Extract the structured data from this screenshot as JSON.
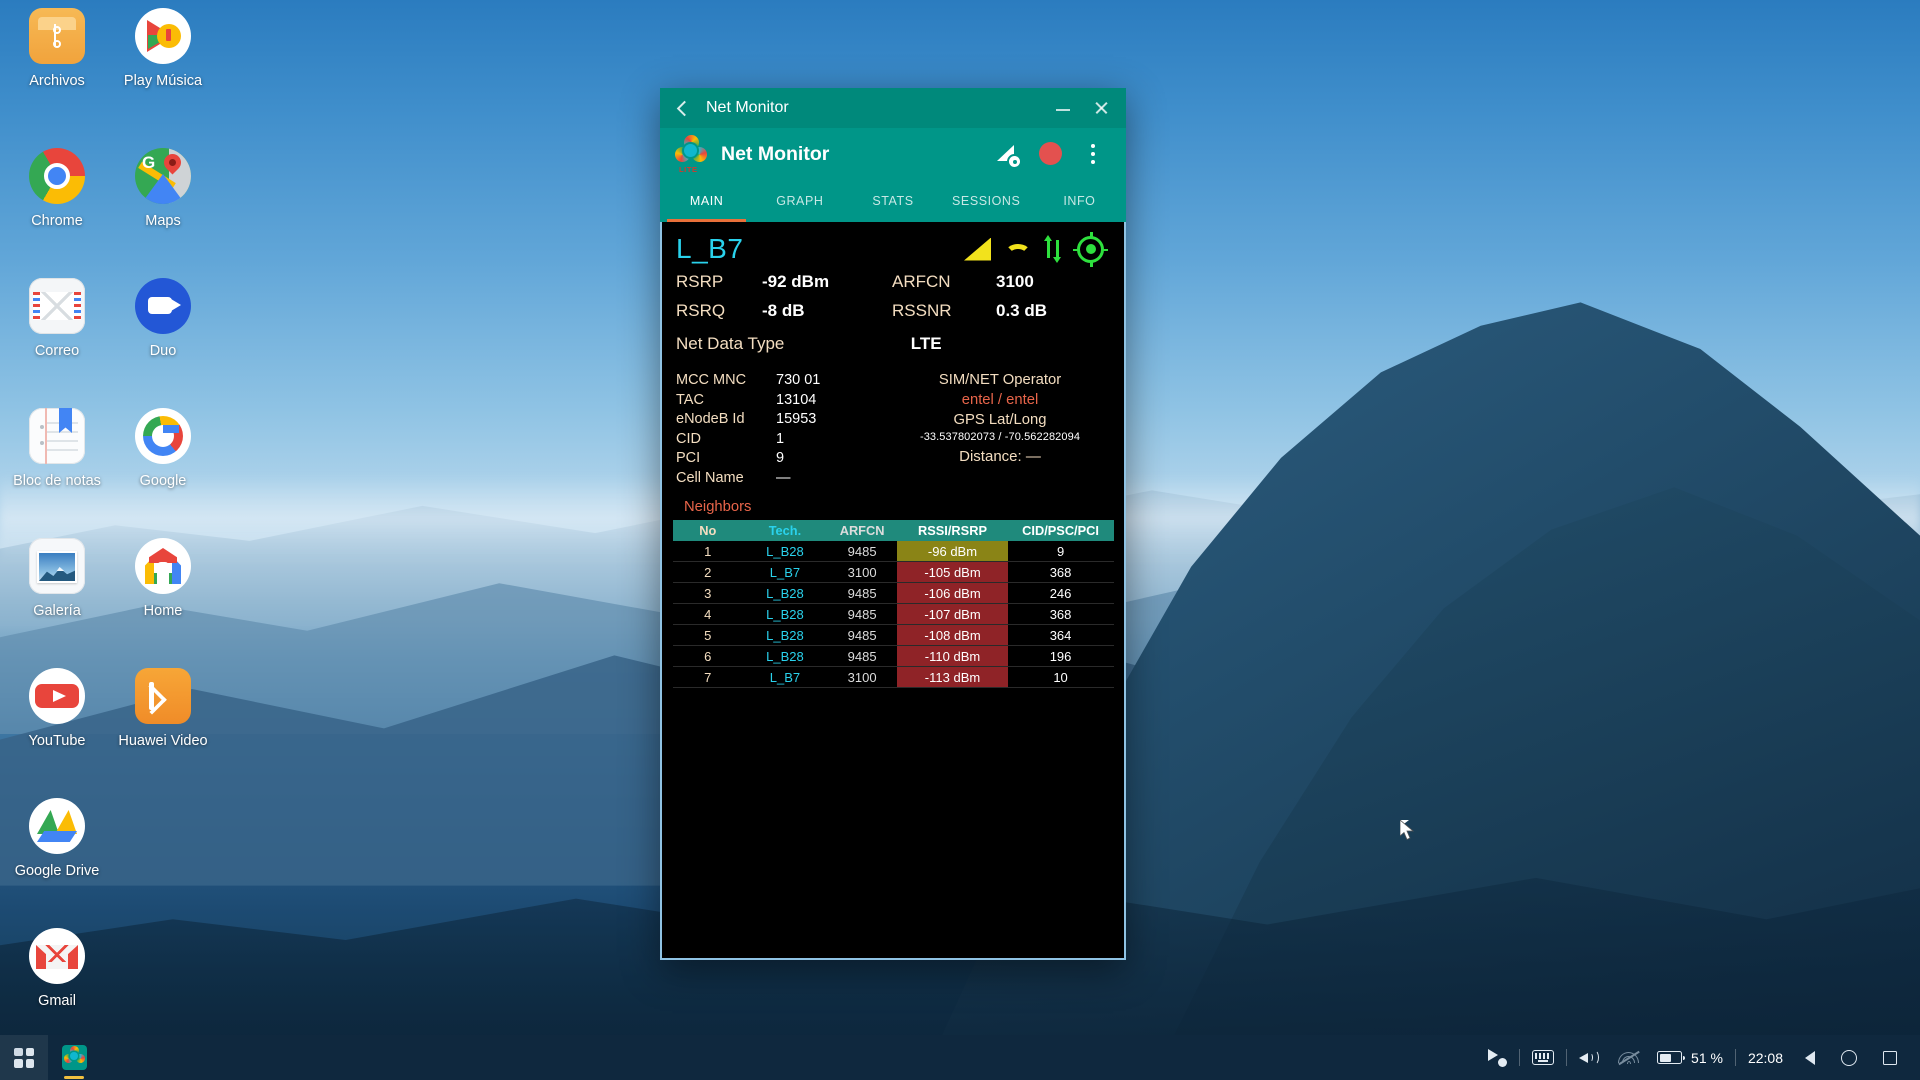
{
  "desktop": {
    "icons": [
      {
        "label": "Archivos",
        "icon": "files-icon"
      },
      {
        "label": "Play Música",
        "icon": "play-music-icon"
      },
      {
        "label": "Chrome",
        "icon": "chrome-icon"
      },
      {
        "label": "Maps",
        "icon": "maps-icon"
      },
      {
        "label": "Correo",
        "icon": "mail-icon"
      },
      {
        "label": "Duo",
        "icon": "duo-icon"
      },
      {
        "label": "Bloc de notas",
        "icon": "notepad-icon"
      },
      {
        "label": "Google",
        "icon": "google-icon"
      },
      {
        "label": "Galería",
        "icon": "gallery-icon"
      },
      {
        "label": "Home",
        "icon": "google-home-icon"
      },
      {
        "label": "YouTube",
        "icon": "youtube-icon"
      },
      {
        "label": "Huawei Video",
        "icon": "huawei-video-icon"
      },
      {
        "label": "Google Drive",
        "icon": "google-drive-icon"
      },
      {
        "label": "Gmail",
        "icon": "gmail-icon"
      }
    ]
  },
  "window": {
    "titlebar": {
      "back_icon": "chevron-left-icon",
      "title": "Net Monitor",
      "minimize_icon": "minimize-icon",
      "close_icon": "close-icon"
    },
    "appbar": {
      "logo_icon": "net-monitor-logo-icon",
      "logo_badge": "LITE",
      "app_name": "Net Monitor",
      "actions": [
        {
          "icon": "signal-settings-icon"
        },
        {
          "icon": "record-icon",
          "color": "#e3514f"
        },
        {
          "icon": "more-vertical-icon"
        }
      ]
    },
    "tabs": [
      {
        "label": "MAIN",
        "active": true
      },
      {
        "label": "GRAPH",
        "active": false
      },
      {
        "label": "STATS",
        "active": false
      },
      {
        "label": "SESSIONS",
        "active": false
      },
      {
        "label": "INFO",
        "active": false
      }
    ],
    "accent_color": "#e8703a",
    "bar_color": "#009688"
  },
  "main": {
    "band": "L_B7",
    "status_icons": [
      {
        "icon": "signal-bars-icon",
        "color": "#f2e21c"
      },
      {
        "icon": "call-end-icon",
        "color": "#f2e21c"
      },
      {
        "icon": "data-transfer-icon",
        "color": "#2ee03e"
      },
      {
        "icon": "gps-fix-icon",
        "color": "#2ee03e"
      }
    ],
    "metrics": [
      {
        "key": "RSRP",
        "value": "-92 dBm",
        "key2": "ARFCN",
        "value2": "3100"
      },
      {
        "key": "RSRQ",
        "value": "-8 dB",
        "key2": "RSSNR",
        "value2": "0.3 dB"
      }
    ],
    "net_data_type": {
      "label": "Net Data Type",
      "value": "LTE"
    },
    "left_fields": [
      {
        "key": "MCC MNC",
        "value": "730 01"
      },
      {
        "key": "TAC",
        "value": "13104"
      },
      {
        "key": "eNodeB Id",
        "value": "15953"
      },
      {
        "key": "CID",
        "value": "1"
      },
      {
        "key": "PCI",
        "value": "9"
      },
      {
        "key": "Cell Name",
        "value": "—"
      }
    ],
    "right_block": {
      "operator_label": "SIM/NET Operator",
      "operator_value": "entel / entel",
      "gps_label": "GPS Lat/Long",
      "gps_value": "-33.537802073 / -70.562282094",
      "distance": "Distance: —"
    },
    "neighbors": {
      "title": "Neighbors",
      "columns": [
        "No",
        "Tech.",
        "ARFCN",
        "RSSI/RSRP",
        "CID/PSC/PCI"
      ],
      "rows": [
        {
          "no": "1",
          "tech": "L_B28",
          "arfcn": "9485",
          "rssi": "-96 dBm",
          "cid": "9",
          "rssi_bg": "#8a8416"
        },
        {
          "no": "2",
          "tech": "L_B7",
          "arfcn": "3100",
          "rssi": "-105 dBm",
          "cid": "368",
          "rssi_bg": "#8f2327"
        },
        {
          "no": "3",
          "tech": "L_B28",
          "arfcn": "9485",
          "rssi": "-106 dBm",
          "cid": "246",
          "rssi_bg": "#8f2327"
        },
        {
          "no": "4",
          "tech": "L_B28",
          "arfcn": "9485",
          "rssi": "-107 dBm",
          "cid": "368",
          "rssi_bg": "#8f2327"
        },
        {
          "no": "5",
          "tech": "L_B28",
          "arfcn": "9485",
          "rssi": "-108 dBm",
          "cid": "364",
          "rssi_bg": "#8f2327"
        },
        {
          "no": "6",
          "tech": "L_B28",
          "arfcn": "9485",
          "rssi": "-110 dBm",
          "cid": "196",
          "rssi_bg": "#8f2327"
        },
        {
          "no": "7",
          "tech": "L_B7",
          "arfcn": "3100",
          "rssi": "-113 dBm",
          "cid": "10",
          "rssi_bg": "#8f2327"
        }
      ]
    }
  },
  "taskbar": {
    "launcher_icon": "app-grid-icon",
    "running_app_icon": "net-monitor-taskbar-icon",
    "tray": [
      {
        "icon": "pointer-check-icon"
      },
      {
        "icon": "keyboard-icon"
      },
      {
        "icon": "volume-icon"
      },
      {
        "icon": "wifi-off-icon"
      }
    ],
    "battery_percent": "51 %",
    "battery_level": 51,
    "clock": "22:08",
    "nav": [
      {
        "icon": "back-triangle-icon"
      },
      {
        "icon": "home-circle-icon"
      },
      {
        "icon": "recents-square-icon"
      }
    ]
  }
}
